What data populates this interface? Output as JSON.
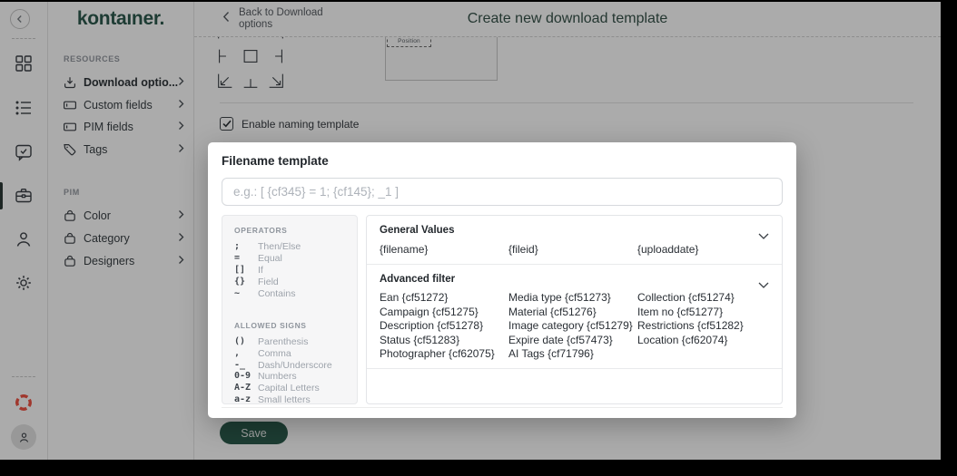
{
  "brand": {
    "logo_text": "kontaıner.",
    "accent_green": "#2e5a4e",
    "logo_mark_red": "#ef5244"
  },
  "header": {
    "back_label": "Back to Download options",
    "title": "Create new download template"
  },
  "sidebar": {
    "sections": [
      {
        "label": "RESOURCES",
        "items": [
          {
            "label": "Download optio...",
            "icon": "download"
          },
          {
            "label": "Custom fields",
            "icon": "input-field"
          },
          {
            "label": "PIM fields",
            "icon": "input-field"
          },
          {
            "label": "Tags",
            "icon": "tag"
          }
        ]
      },
      {
        "label": "PIM",
        "items": [
          {
            "label": "Color",
            "icon": "basket"
          },
          {
            "label": "Category",
            "icon": "basket"
          },
          {
            "label": "Designers",
            "icon": "basket"
          }
        ]
      }
    ]
  },
  "content": {
    "position_preview_label": "Position",
    "enable_checkbox_label": "Enable naming template",
    "enable_checkbox_checked": true,
    "save_label": "Save"
  },
  "modal": {
    "title": "Filename template",
    "input_placeholder": "e.g.: [ {cf345} = 1; {cf145}; _1 ]",
    "operators": {
      "label": "OPERATORS",
      "items": [
        {
          "symbol": ";",
          "desc": "Then/Else"
        },
        {
          "symbol": "=",
          "desc": "Equal"
        },
        {
          "symbol": "[]",
          "desc": "If"
        },
        {
          "symbol": "{}",
          "desc": "Field"
        },
        {
          "symbol": "~",
          "desc": "Contains"
        }
      ]
    },
    "allowed_signs": {
      "label": "ALLOWED SIGNS",
      "items": [
        {
          "symbol": "()",
          "desc": "Parenthesis"
        },
        {
          "symbol": ",",
          "desc": "Comma"
        },
        {
          "symbol": "-_",
          "desc": "Dash/Underscore"
        },
        {
          "symbol": "0-9",
          "desc": "Numbers"
        },
        {
          "symbol": "A-Z",
          "desc": "Capital Letters"
        },
        {
          "symbol": "a-z",
          "desc": "Small letters"
        }
      ]
    },
    "general_values": {
      "label": "General Values",
      "items": [
        "{filename}",
        "{fileid}",
        "{uploaddate}"
      ]
    },
    "advanced_filter": {
      "label": "Advanced filter",
      "items": [
        "Ean {cf51272}",
        "Media type {cf51273}",
        "Collection {cf51274}",
        "Campaign {cf51275}",
        "Material {cf51276}",
        "Item no {cf51277}",
        "Description {cf51278}",
        "Image category {cf51279}",
        "Restrictions {cf51282}",
        "Status {cf51283}",
        "Expire date {cf57473}",
        "Location {cf62074}",
        "Photographer {cf62075}",
        "AI Tags {cf71796}"
      ]
    }
  }
}
